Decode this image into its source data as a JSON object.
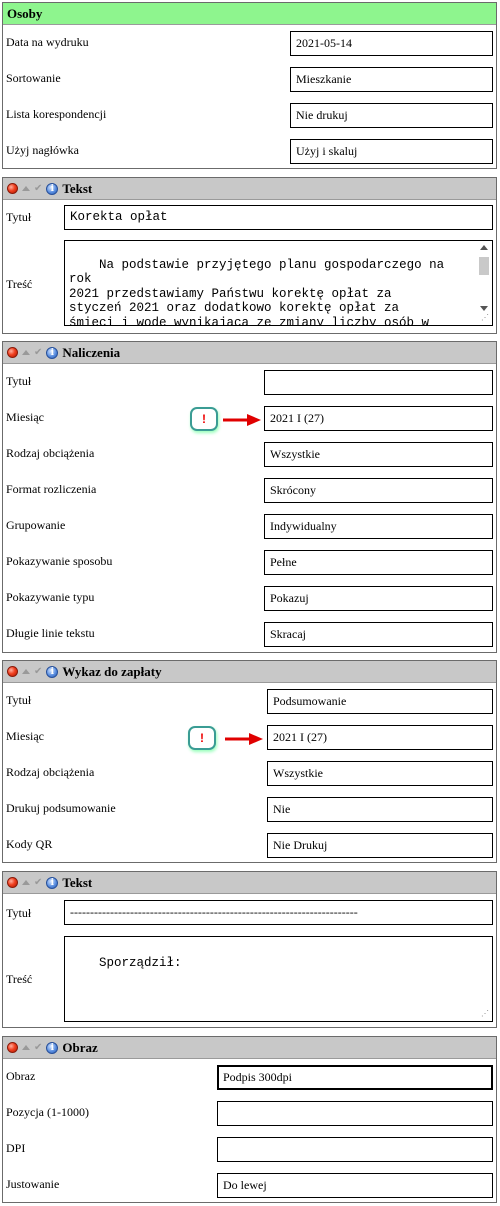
{
  "osoby": {
    "title": "Osoby",
    "rows": [
      {
        "label": "Data na wydruku",
        "value": "2021-05-14"
      },
      {
        "label": "Sortowanie",
        "value": "Mieszkanie"
      },
      {
        "label": "Lista korespondencji",
        "value": "Nie drukuj"
      },
      {
        "label": "Użyj nagłówka",
        "value": "Użyj i skaluj"
      }
    ]
  },
  "tekst1": {
    "title": "Tekst",
    "tytul_label": "Tytuł",
    "tytul_value": "Korekta opłat",
    "tresc_label": "Treść",
    "tresc_value": "Na podstawie przyjętego planu gospodarczego na rok\n2021 przedstawiamy Państwu korektę opłat za\nstyczeń 2021 oraz dodatkowo korektę opłat za\nśmieci i wodę wynikającą ze zmiany liczby osób w\nlokalu i prognozy. Kwotę określoną jako \"Do"
  },
  "naliczenia": {
    "title": "Naliczenia",
    "rows": [
      {
        "label": "Tytuł",
        "value": ""
      },
      {
        "label": "Miesiąc",
        "value": "2021 I (27)"
      },
      {
        "label": "Rodzaj obciążenia",
        "value": "Wszystkie"
      },
      {
        "label": "Format rozliczenia",
        "value": "Skrócony"
      },
      {
        "label": "Grupowanie",
        "value": "Indywidualny"
      },
      {
        "label": "Pokazywanie sposobu",
        "value": "Pełne"
      },
      {
        "label": "Pokazywanie typu",
        "value": "Pokazuj"
      },
      {
        "label": "Długie linie tekstu",
        "value": "Skracaj"
      }
    ],
    "warning": "!"
  },
  "wykaz": {
    "title": "Wykaz do zapłaty",
    "rows": [
      {
        "label": "Tytuł",
        "value": "Podsumowanie"
      },
      {
        "label": "Miesiąc",
        "value": "2021 I (27)"
      },
      {
        "label": "Rodzaj obciążenia",
        "value": "Wszystkie"
      },
      {
        "label": "Drukuj podsumowanie",
        "value": "Nie"
      },
      {
        "label": "Kody QR",
        "value": "Nie Drukuj"
      }
    ],
    "warning": "!"
  },
  "tekst2": {
    "title": "Tekst",
    "tytul_label": "Tytuł",
    "tytul_value": "------------------------------------------------------------------------",
    "tresc_label": "Treść",
    "tresc_value": "Sporządził:"
  },
  "obraz": {
    "title": "Obraz",
    "rows": [
      {
        "label": "Obraz",
        "value": "Podpis 300dpi"
      },
      {
        "label": "Pozycja (1-1000)",
        "value": ""
      },
      {
        "label": "DPI",
        "value": ""
      },
      {
        "label": "Justowanie",
        "value": "Do lewej"
      }
    ]
  },
  "icons": [
    "close-icon",
    "move-up-icon",
    "check-icon",
    "info-icon"
  ],
  "colors": {
    "osoby_header": "#8ef58e",
    "panel_header": "#c8c8c8",
    "warning_border": "#3a9c94",
    "arrow": "#e00000"
  }
}
